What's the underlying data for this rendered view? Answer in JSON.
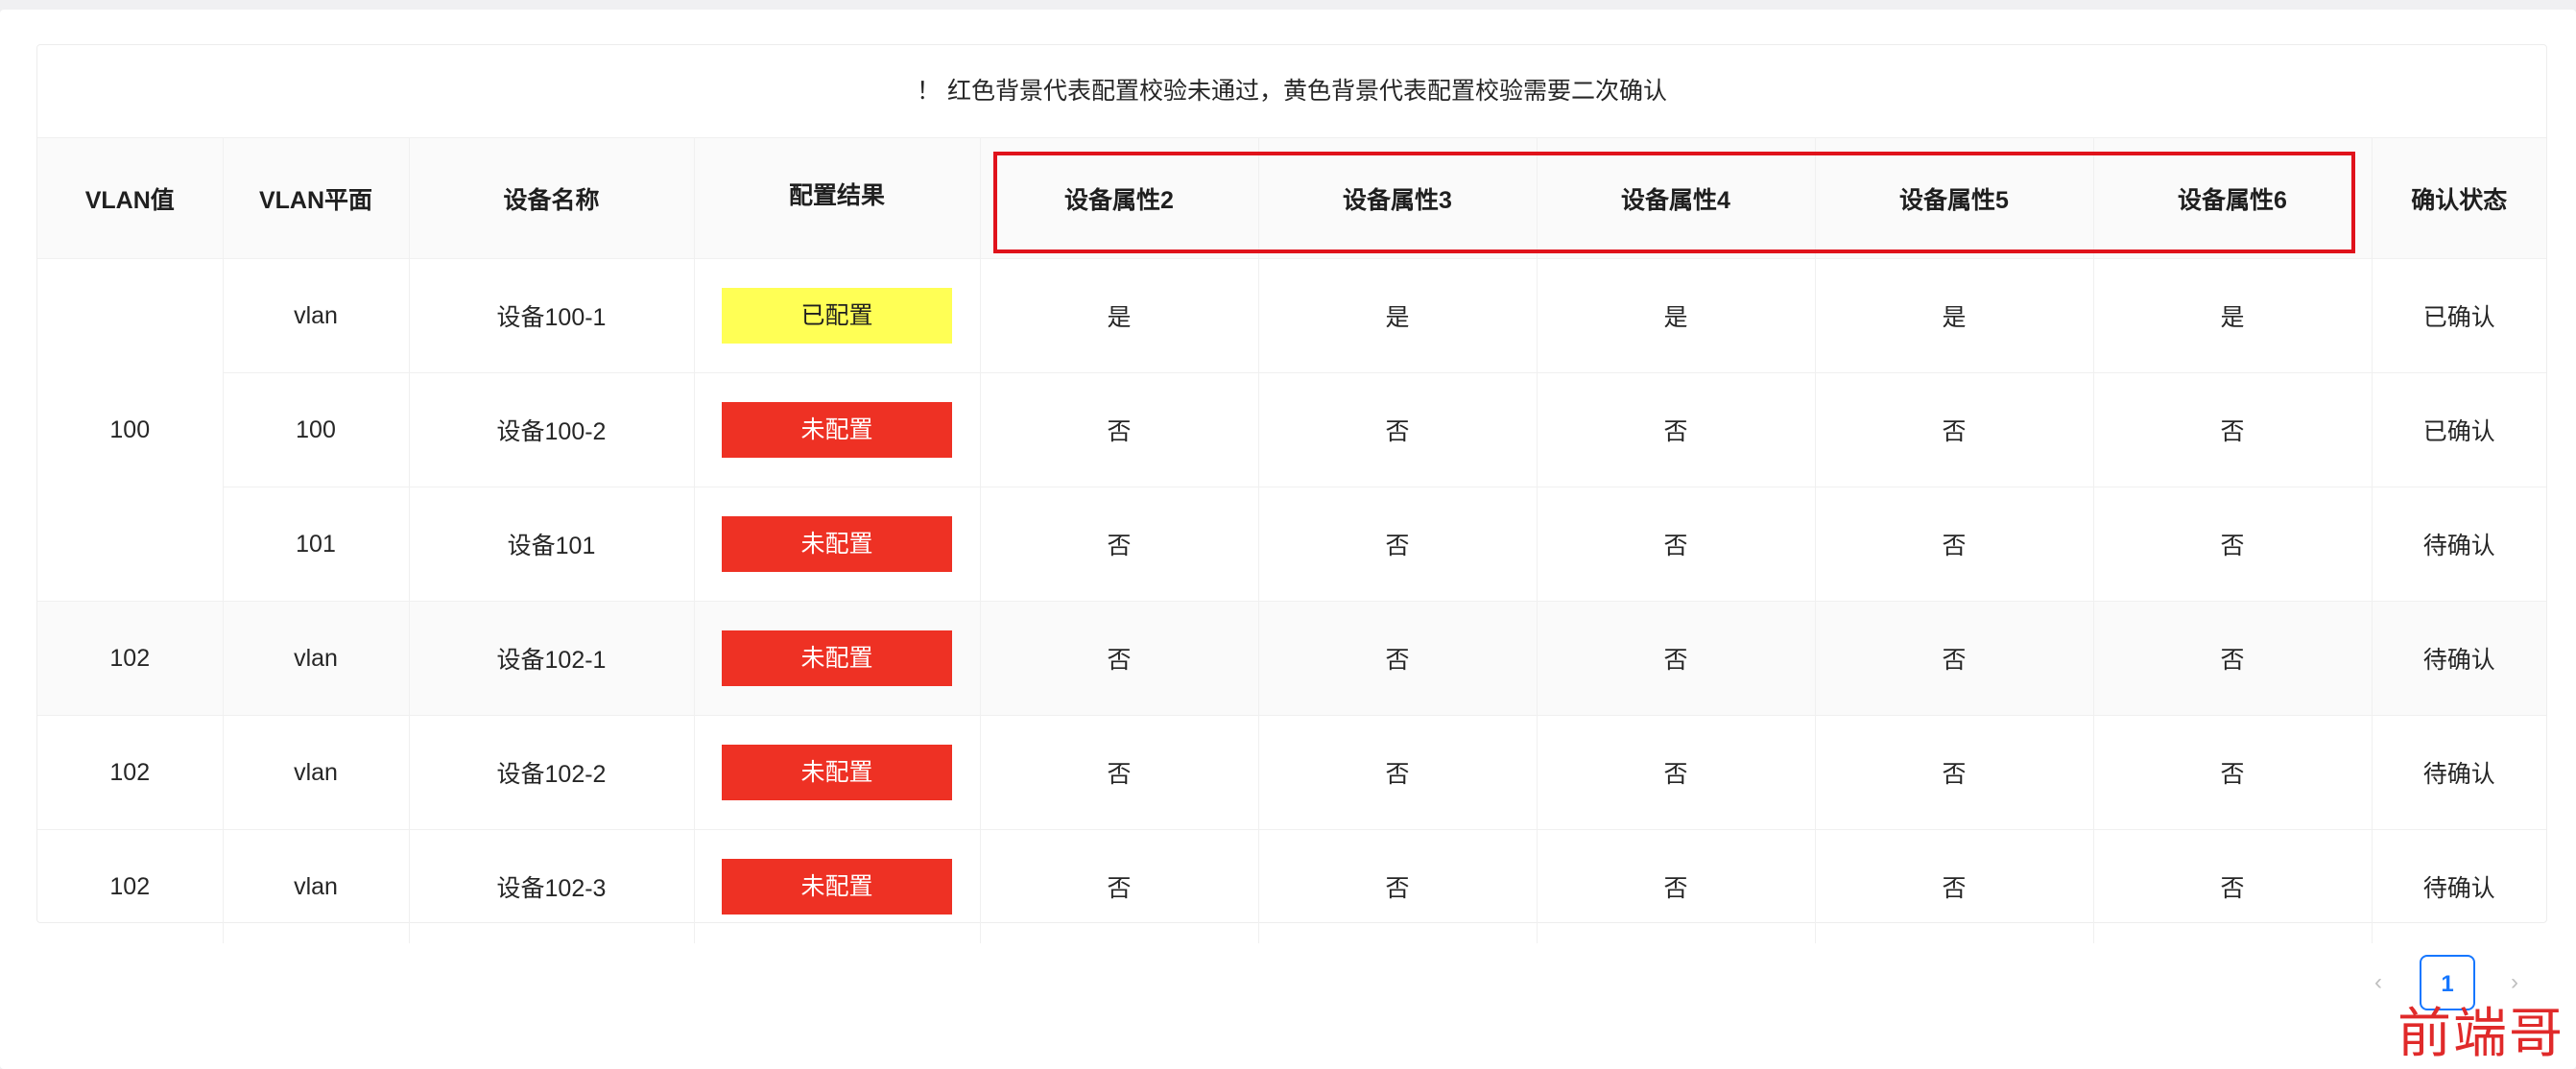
{
  "notice": "！ 红色背景代表配置校验未通过，黄色背景代表配置校验需要二次确认",
  "columns": [
    "VLAN值",
    "VLAN平面",
    "设备名称",
    "配置结果",
    "设备属性2",
    "设备属性3",
    "设备属性4",
    "设备属性5",
    "设备属性6",
    "确认状态"
  ],
  "rows": [
    {
      "vlan": "100",
      "plane": "vlan",
      "device": "设备100-1",
      "result": "已配置",
      "result_color": "#ffff55",
      "attrs": [
        "是",
        "是",
        "是",
        "是",
        "是"
      ],
      "status": "已确认"
    },
    {
      "vlan": "100",
      "plane": "100",
      "device": "设备100-2",
      "result": "未配置",
      "result_color": "#ee3124",
      "attrs": [
        "否",
        "否",
        "否",
        "否",
        "否"
      ],
      "status": "已确认"
    },
    {
      "vlan": "100",
      "plane": "101",
      "device": "设备101",
      "result": "未配置",
      "result_color": "#ee3124",
      "attrs": [
        "否",
        "否",
        "否",
        "否",
        "否"
      ],
      "status": "待确认"
    },
    {
      "vlan": "102",
      "plane": "vlan",
      "device": "设备102-1",
      "result": "未配置",
      "result_color": "#ee3124",
      "attrs": [
        "否",
        "否",
        "否",
        "否",
        "否"
      ],
      "status": "待确认"
    },
    {
      "vlan": "102",
      "plane": "vlan",
      "device": "设备102-2",
      "result": "未配置",
      "result_color": "#ee3124",
      "attrs": [
        "否",
        "否",
        "否",
        "否",
        "否"
      ],
      "status": "待确认"
    },
    {
      "vlan": "102",
      "plane": "vlan",
      "device": "设备102-3",
      "result": "未配置",
      "result_color": "#ee3124",
      "attrs": [
        "否",
        "否",
        "否",
        "否",
        "否"
      ],
      "status": "待确认"
    }
  ],
  "pagination": {
    "prev_icon": "chevron-left-icon",
    "current_page": "1",
    "next_icon": "chevron-right-icon"
  },
  "watermark": "前端哥",
  "colors": {
    "highlight_border": "#e0121b",
    "unconfigured": "#ee3124",
    "needs_confirm": "#ffff55",
    "accent": "#1677ff"
  }
}
